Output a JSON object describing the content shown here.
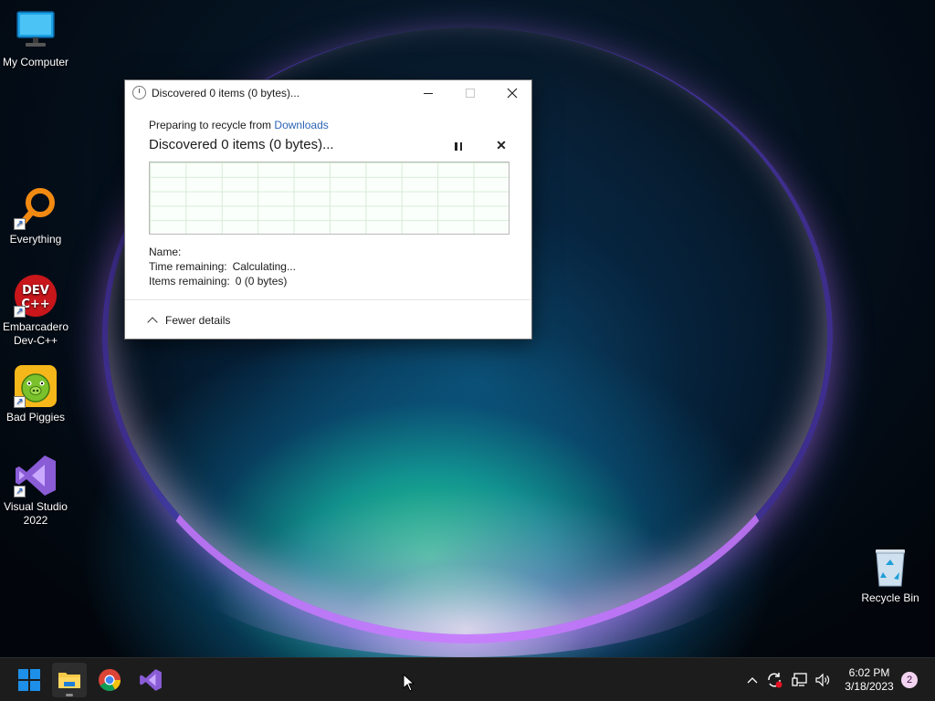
{
  "desktop": {
    "icons": [
      {
        "label": "My Computer",
        "icon": "monitor-icon"
      },
      {
        "label": "Everything",
        "icon": "magnifier-icon"
      },
      {
        "label": "Embarcadero Dev-C++",
        "icon": "devcpp-icon",
        "badge": "DEV C++"
      },
      {
        "label": "Bad Piggies",
        "icon": "pig-icon"
      },
      {
        "label": "Visual Studio 2022",
        "icon": "visual-studio-icon"
      },
      {
        "label": "Recycle Bin",
        "icon": "recycle-bin-icon"
      }
    ]
  },
  "dialog": {
    "title": "Discovered 0 items (0 bytes)...",
    "prep_text": "Preparing to recycle from",
    "prep_link": "Downloads",
    "status": "Discovered 0 items (0 bytes)...",
    "details": {
      "name_label": "Name:",
      "name_value": "",
      "time_label": "Time remaining:",
      "time_value": "Calculating...",
      "items_label": "Items remaining:",
      "items_value": "0 (0 bytes)"
    },
    "fewer_details": "Fewer details"
  },
  "taskbar": {
    "apps": [
      "start-icon",
      "file-explorer-icon",
      "chrome-icon",
      "visual-studio-icon"
    ],
    "tray_icons": [
      "chevron-up-icon",
      "sync-icon",
      "network-icon",
      "volume-icon"
    ],
    "time": "6:02 PM",
    "date": "3/18/2023",
    "notifications": "2"
  },
  "colors": {
    "accent_link": "#2a64b6",
    "taskbar_bg": "#1c1c1c",
    "windows_blue": "#1d8fe8"
  }
}
